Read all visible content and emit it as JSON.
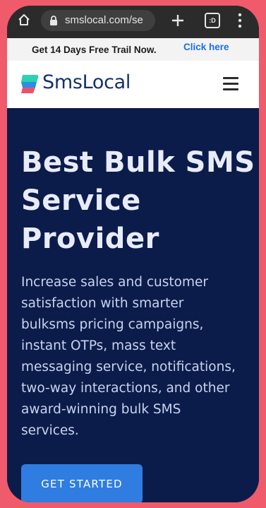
{
  "browser": {
    "url": "smslocal.com/se",
    "tab_count_glyph": ":D"
  },
  "promo": {
    "text": "Get 14 Days Free Trail Now.",
    "link_label": "Click here"
  },
  "header": {
    "brand": "SmsLocal"
  },
  "hero": {
    "title_lines": [
      "Best Bulk SMS",
      "Service",
      "Provider"
    ],
    "description_lines": [
      "Increase sales and customer",
      "satisfaction with smarter",
      "bulksms pricing campaigns,",
      "instant OTPs, mass text",
      "messaging service, notifications,",
      "two-way interactions, and other",
      "award-winning bulk SMS",
      "services."
    ],
    "cta_label": "GET STARTED"
  },
  "colors": {
    "frame": "#ef5b6b",
    "hero_bg": "#0c1c4a",
    "accent": "#2f7de1",
    "brand_text": "#16306b",
    "link": "#1e6ee6"
  },
  "icons": [
    "home-icon",
    "lock-icon",
    "plus-icon",
    "tabs-icon",
    "menu-dots-icon",
    "logo-mark-icon",
    "hamburger-icon"
  ]
}
